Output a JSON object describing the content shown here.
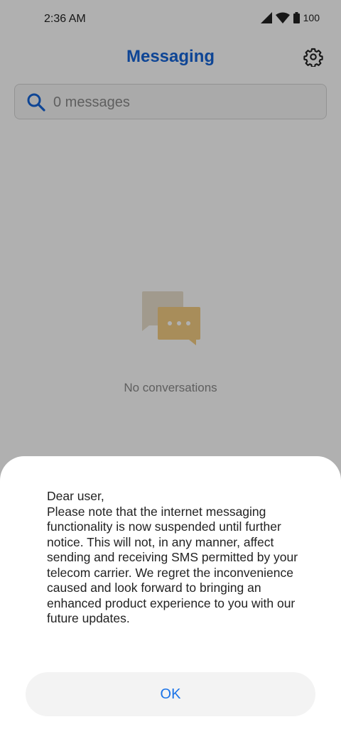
{
  "status_bar": {
    "time": "2:36 AM",
    "battery": "100",
    "icons": [
      "signal-icon",
      "wifi-icon",
      "battery-icon"
    ]
  },
  "header": {
    "title": "Messaging",
    "settings_icon": "gear-icon"
  },
  "search": {
    "placeholder": "0 messages",
    "icon": "search-icon"
  },
  "empty_state": {
    "icon": "chat-bubbles-icon",
    "text": "No conversations"
  },
  "dialog": {
    "greeting": "Dear user,",
    "message": "Please note that the internet messaging functionality is now suspended until further notice. This will not, in any manner, affect sending and receiving SMS permitted by your telecom carrier. We regret the inconvenience caused and look forward to bringing an enhanced product experience to you with our future updates.",
    "ok_label": "OK"
  },
  "colors": {
    "accent": "#1565d8",
    "ok_text": "#1a73e8",
    "overlay": "rgba(0,0,0,0.31)"
  }
}
